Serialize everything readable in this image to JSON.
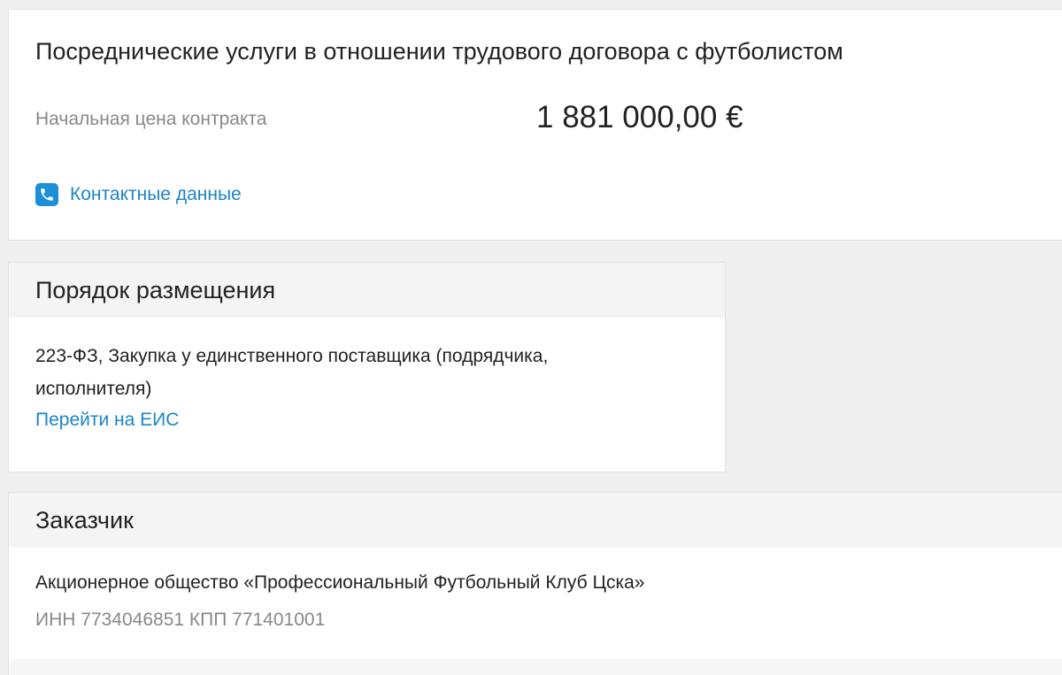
{
  "contract": {
    "title": "Посреднические услуги в отношении трудового договора с футболистом",
    "price_label": "Начальная цена контракта",
    "price_value": "1 881 000,00 €",
    "contact_link": "Контактные данные",
    "contact_icon": "phone-icon"
  },
  "placement": {
    "header": "Порядок размещения",
    "description": "223-ФЗ, Закупка у единственного поставщика (подрядчика, исполнителя)",
    "link": "Перейти на ЕИС"
  },
  "customer": {
    "header": "Заказчик",
    "name": "Акционерное общество «Профессиональный Футбольный Клуб Цска»",
    "ids": "ИНН 7734046851 КПП 771401001"
  },
  "colors": {
    "accent": "#1a86c8",
    "icon_bg": "#1d8fd8",
    "muted_text": "#888888",
    "background": "#efefef"
  }
}
